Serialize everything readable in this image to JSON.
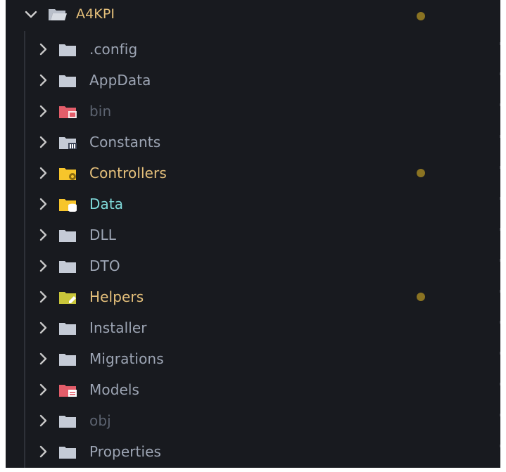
{
  "root": {
    "label": "A4KPI",
    "color": "#e5c07b",
    "modified": true
  },
  "colors": {
    "chevron": "#c8c8c8",
    "dot": "#8a7322",
    "default_text": "#9da5b4",
    "dim_text": "#5c6370",
    "yellow_text": "#e5c07b",
    "teal_text": "#7fd8d8"
  },
  "items": [
    {
      "label": ".config",
      "icon": "folder-icon",
      "icon_color": "#c5cbd6",
      "text_color": "#9da5b4",
      "modified": false
    },
    {
      "label": "AppData",
      "icon": "folder-icon",
      "icon_color": "#c5cbd6",
      "text_color": "#9da5b4",
      "modified": false
    },
    {
      "label": "bin",
      "icon": "bin-folder-icon",
      "icon_color": "#e35d6a",
      "text_color": "#5c6370",
      "modified": false
    },
    {
      "label": "Constants",
      "icon": "constants-folder-icon",
      "icon_color": "#c5cbd6",
      "text_color": "#9da5b4",
      "modified": false
    },
    {
      "label": "Controllers",
      "icon": "controllers-folder-icon",
      "icon_color": "#f7c52b",
      "text_color": "#e5c07b",
      "modified": true
    },
    {
      "label": "Data",
      "icon": "data-folder-icon",
      "icon_color": "#f7c52b",
      "text_color": "#7fd8d8",
      "modified": false
    },
    {
      "label": "DLL",
      "icon": "folder-icon",
      "icon_color": "#c5cbd6",
      "text_color": "#9da5b4",
      "modified": false
    },
    {
      "label": "DTO",
      "icon": "folder-icon",
      "icon_color": "#c5cbd6",
      "text_color": "#9da5b4",
      "modified": false
    },
    {
      "label": "Helpers",
      "icon": "helpers-folder-icon",
      "icon_color": "#c9c63a",
      "text_color": "#e5c07b",
      "modified": true
    },
    {
      "label": "Installer",
      "icon": "folder-icon",
      "icon_color": "#c5cbd6",
      "text_color": "#9da5b4",
      "modified": false
    },
    {
      "label": "Migrations",
      "icon": "folder-icon",
      "icon_color": "#c5cbd6",
      "text_color": "#9da5b4",
      "modified": false
    },
    {
      "label": "Models",
      "icon": "models-folder-icon",
      "icon_color": "#e35d6a",
      "text_color": "#9da5b4",
      "modified": false
    },
    {
      "label": "obj",
      "icon": "folder-icon",
      "icon_color": "#c5cbd6",
      "text_color": "#5c6370",
      "modified": false
    },
    {
      "label": "Properties",
      "icon": "folder-icon",
      "icon_color": "#c5cbd6",
      "text_color": "#9da5b4",
      "modified": false
    }
  ]
}
